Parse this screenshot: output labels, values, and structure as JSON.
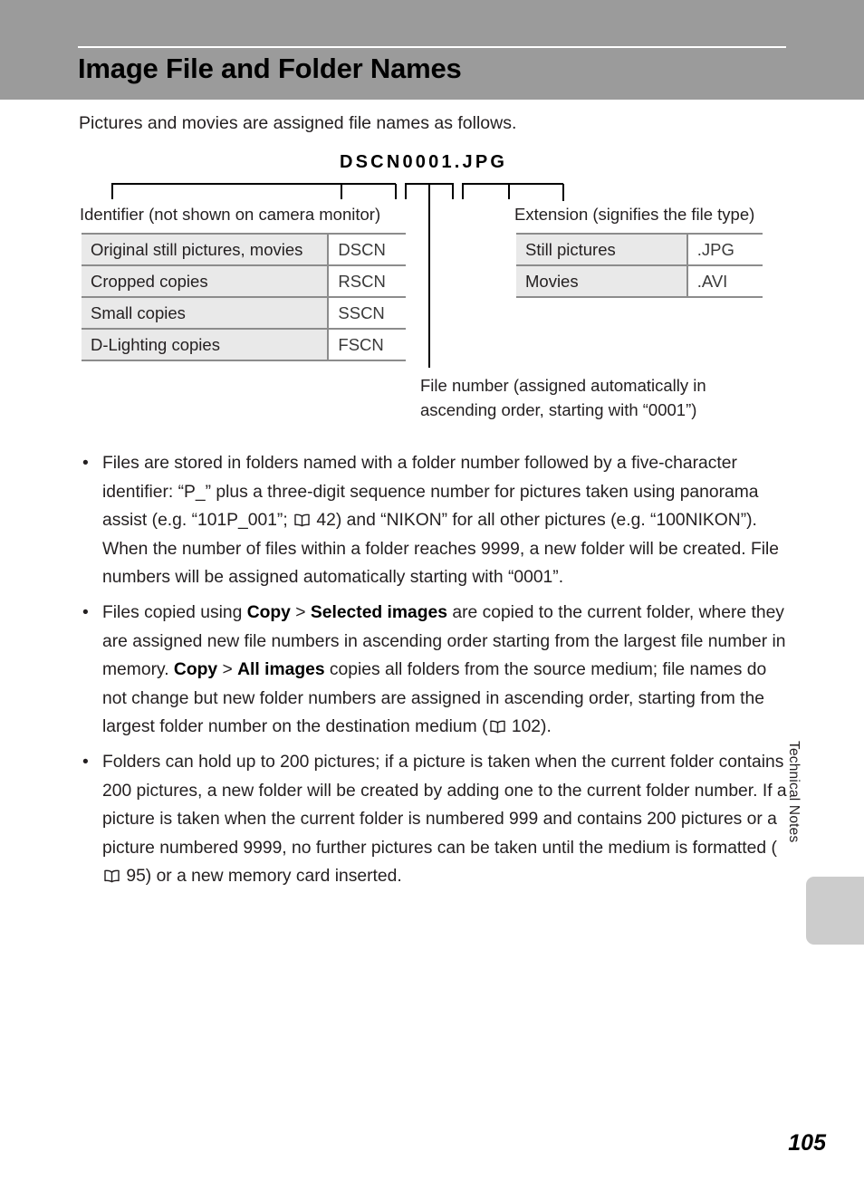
{
  "header": {
    "title": "Image File and Folder Names",
    "band_color": "#9b9b9b"
  },
  "intro": "Pictures and movies are assigned file names as follows.",
  "diagram": {
    "filename_sample": "DSCN0001.JPG",
    "identifier_caption": "Identifier (not shown on camera monitor)",
    "extension_caption": "Extension (signifies the file type)",
    "filenumber_caption": "File number (assigned automatically in ascending order, starting with “0001”)"
  },
  "identifier_table": {
    "rows": [
      {
        "label": "Original still pictures, movies",
        "value": "DSCN"
      },
      {
        "label": "Cropped copies",
        "value": "RSCN"
      },
      {
        "label": "Small copies",
        "value": "SSCN"
      },
      {
        "label": "D-Lighting copies",
        "value": "FSCN"
      }
    ]
  },
  "extension_table": {
    "rows": [
      {
        "label": "Still pictures",
        "value": ".JPG"
      },
      {
        "label": "Movies",
        "value": ".AVI"
      }
    ]
  },
  "bullets": [
    {
      "marker": "•",
      "parts": [
        {
          "text": "Files are stored in folders named with a folder number followed by a five-character identifier: “P_” plus a three-digit sequence number for pictures taken using panorama assist (e.g. “101P_001”; "
        },
        {
          "icon": "book-icon"
        },
        {
          "text": " 42) and “NIKON” for all other pictures (e.g. “100NIKON”). When the number of files within a folder reaches 9999, a new folder will be created. File numbers will be assigned automatically starting with “0001”."
        }
      ]
    },
    {
      "marker": "•",
      "parts": [
        {
          "text": "Files copied using "
        },
        {
          "text": "Copy",
          "bold": true
        },
        {
          "text": " > "
        },
        {
          "text": "Selected images",
          "bold": true
        },
        {
          "text": " are copied to the current folder, where they are assigned new file numbers in ascending order starting from the largest file number in memory. "
        },
        {
          "text": "Copy",
          "bold": true
        },
        {
          "text": " > "
        },
        {
          "text": "All images",
          "bold": true
        },
        {
          "text": " copies all folders from the source medium; file names do not change but new folder numbers are assigned in ascending order, starting from the largest folder number on the destination medium ("
        },
        {
          "icon": "book-icon"
        },
        {
          "text": " 102)."
        }
      ]
    },
    {
      "marker": "•",
      "parts": [
        {
          "text": "Folders can hold up to 200 pictures; if a picture is taken when the current folder contains 200 pictures, a new folder will be created by adding one to the current folder number. If a picture is taken when the current folder is numbered 999 and contains 200 pictures or a picture numbered 9999, no further pictures can be taken until the medium is formatted ("
        },
        {
          "icon": "book-icon"
        },
        {
          "text": " 95) or a new memory card inserted."
        }
      ]
    }
  ],
  "margin": {
    "section_label": "Technical Notes",
    "tab_color": "#cccccc"
  },
  "page_number": "105"
}
